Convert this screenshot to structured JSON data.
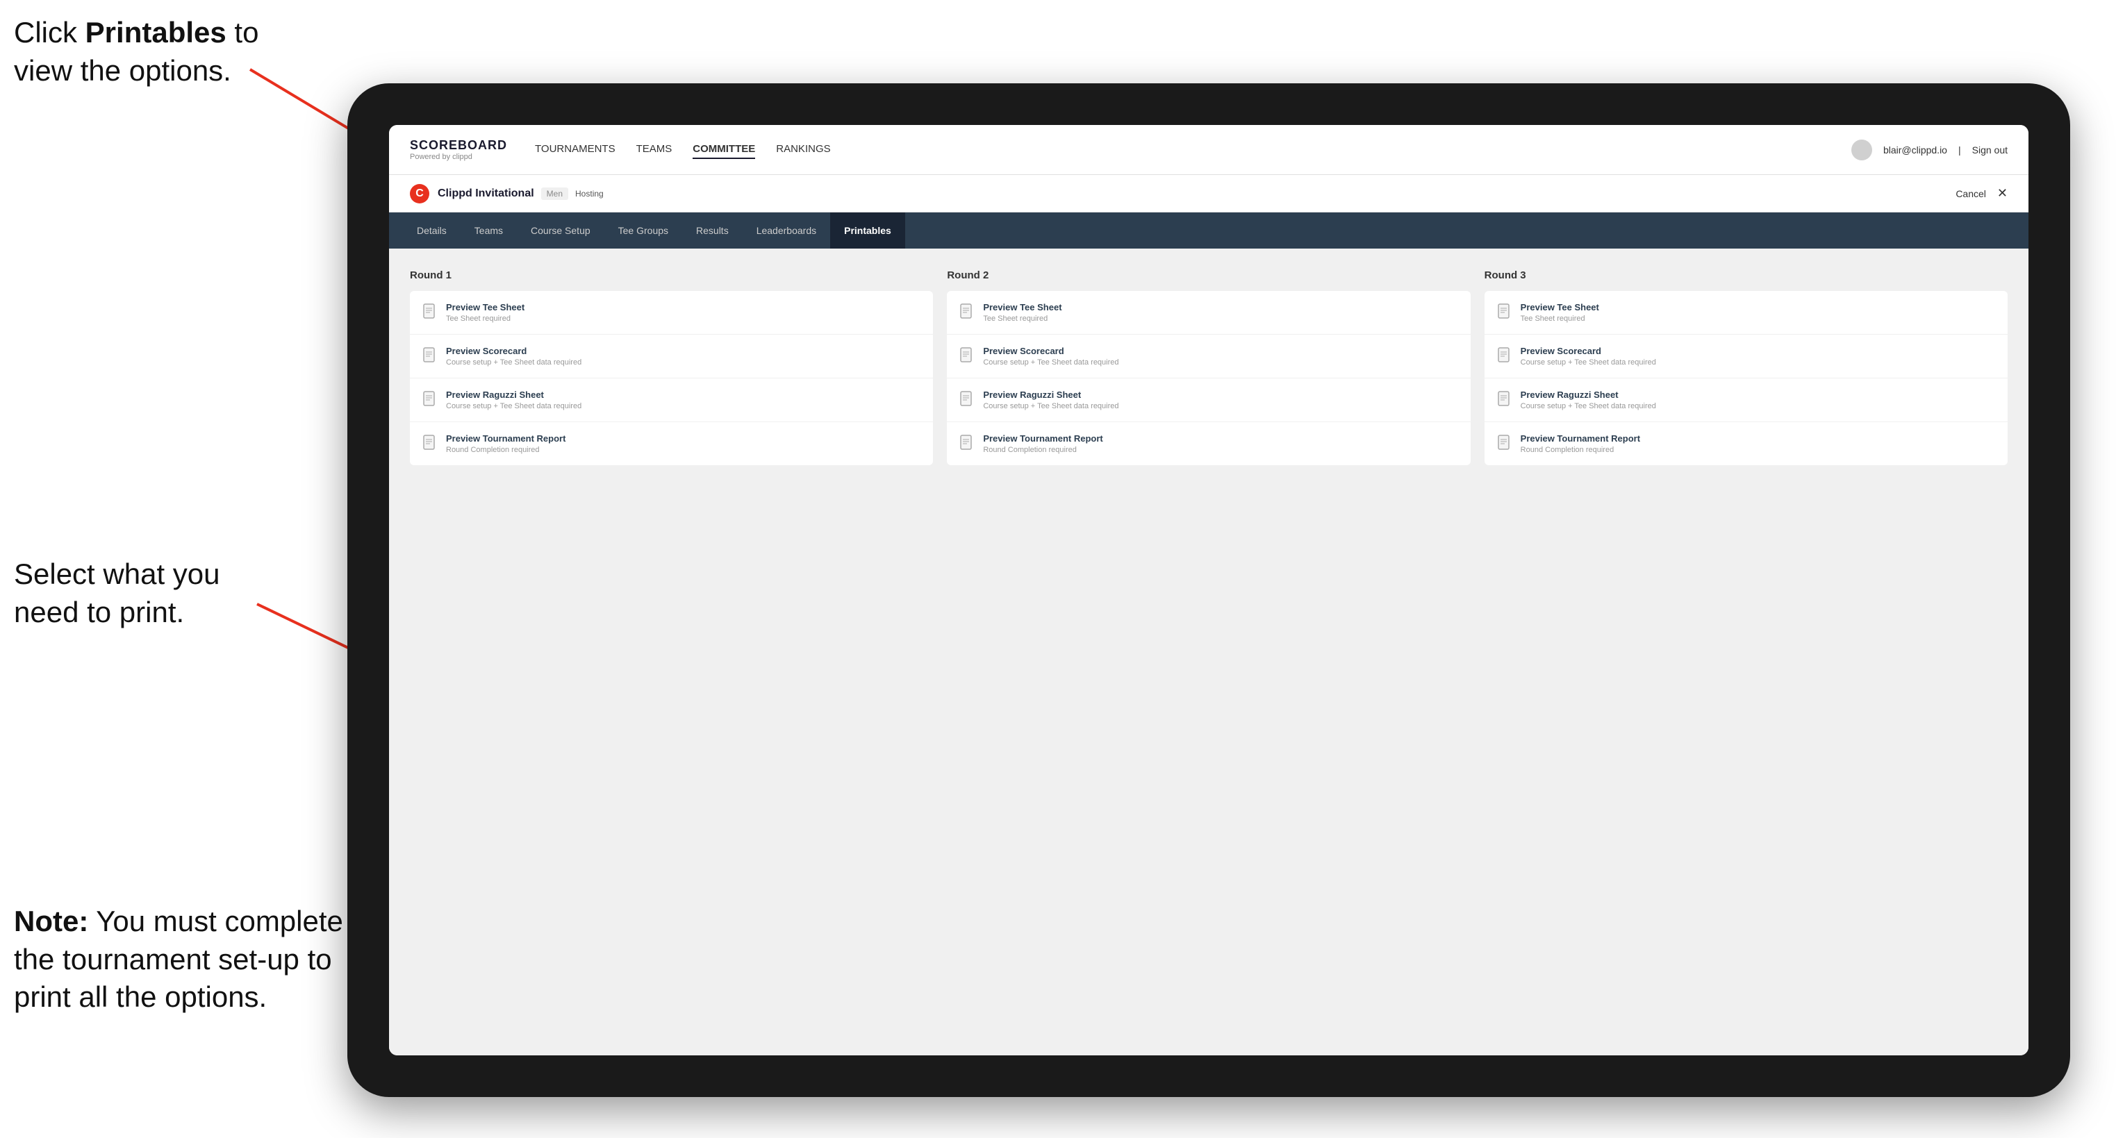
{
  "annotations": {
    "top": {
      "prefix": "Click ",
      "bold": "Printables",
      "suffix": " to view the options."
    },
    "mid": {
      "text": "Select what you need to print."
    },
    "bottom": {
      "bold": "Note:",
      "suffix": " You must complete the tournament set-up to print all the options."
    }
  },
  "topNav": {
    "logo": {
      "title": "SCOREBOARD",
      "sub": "Powered by clippd"
    },
    "links": [
      {
        "label": "TOURNAMENTS",
        "active": false
      },
      {
        "label": "TEAMS",
        "active": false
      },
      {
        "label": "COMMITTEE",
        "active": false
      },
      {
        "label": "RANKINGS",
        "active": false
      }
    ],
    "user": "blair@clippd.io",
    "signout": "Sign out"
  },
  "tournamentHeader": {
    "icon": "C",
    "name": "Clippd Invitational",
    "badge": "Men",
    "status": "Hosting",
    "cancel": "Cancel"
  },
  "tabs": [
    {
      "label": "Details",
      "active": false
    },
    {
      "label": "Teams",
      "active": false
    },
    {
      "label": "Course Setup",
      "active": false
    },
    {
      "label": "Tee Groups",
      "active": false
    },
    {
      "label": "Results",
      "active": false
    },
    {
      "label": "Leaderboards",
      "active": false
    },
    {
      "label": "Printables",
      "active": true
    }
  ],
  "rounds": [
    {
      "title": "Round 1",
      "items": [
        {
          "label": "Preview Tee Sheet",
          "sub": "Tee Sheet required"
        },
        {
          "label": "Preview Scorecard",
          "sub": "Course setup + Tee Sheet data required"
        },
        {
          "label": "Preview Raguzzi Sheet",
          "sub": "Course setup + Tee Sheet data required"
        },
        {
          "label": "Preview Tournament Report",
          "sub": "Round Completion required"
        }
      ]
    },
    {
      "title": "Round 2",
      "items": [
        {
          "label": "Preview Tee Sheet",
          "sub": "Tee Sheet required"
        },
        {
          "label": "Preview Scorecard",
          "sub": "Course setup + Tee Sheet data required"
        },
        {
          "label": "Preview Raguzzi Sheet",
          "sub": "Course setup + Tee Sheet data required"
        },
        {
          "label": "Preview Tournament Report",
          "sub": "Round Completion required"
        }
      ]
    },
    {
      "title": "Round 3",
      "items": [
        {
          "label": "Preview Tee Sheet",
          "sub": "Tee Sheet required"
        },
        {
          "label": "Preview Scorecard",
          "sub": "Course setup + Tee Sheet data required"
        },
        {
          "label": "Preview Raguzzi Sheet",
          "sub": "Course setup + Tee Sheet data required"
        },
        {
          "label": "Preview Tournament Report",
          "sub": "Round Completion required"
        }
      ]
    }
  ]
}
